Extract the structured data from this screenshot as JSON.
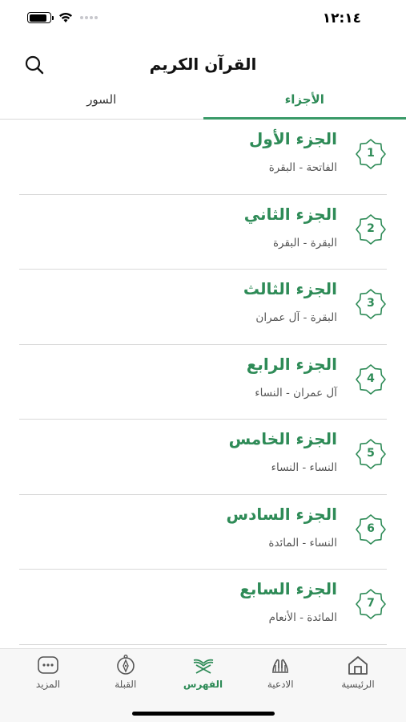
{
  "status": {
    "time": "١٢:١٤",
    "battery_level": 0.85
  },
  "header": {
    "title": "القرآن الكريم",
    "search_icon": "search-icon"
  },
  "tabs": [
    {
      "label": "الأجزاء",
      "active": true
    },
    {
      "label": "السور",
      "active": false
    }
  ],
  "juz_list": [
    {
      "number": "1",
      "title": "الجزء الأول",
      "range": "الفاتحة - البقرة"
    },
    {
      "number": "2",
      "title": "الجزء الثاني",
      "range": "البقرة - البقرة"
    },
    {
      "number": "3",
      "title": "الجزء الثالث",
      "range": "البقرة - آل عمران"
    },
    {
      "number": "4",
      "title": "الجزء الرابع",
      "range": "آل عمران - النساء"
    },
    {
      "number": "5",
      "title": "الجزء الخامس",
      "range": "النساء - النساء"
    },
    {
      "number": "6",
      "title": "الجزء السادس",
      "range": "النساء - المائدة"
    },
    {
      "number": "7",
      "title": "الجزء السابع",
      "range": "المائدة - الأنعام"
    }
  ],
  "tabbar": [
    {
      "label": "الرئيسية",
      "icon": "home-icon",
      "active": false
    },
    {
      "label": "الادعية",
      "icon": "praying-hands-icon",
      "active": false
    },
    {
      "label": "الفهرس",
      "icon": "quran-stand-icon",
      "active": true
    },
    {
      "label": "القبلة",
      "icon": "compass-icon",
      "active": false
    },
    {
      "label": "المزيد",
      "icon": "more-icon",
      "active": false
    }
  ],
  "colors": {
    "accent": "#2e8b57",
    "divider": "#d9d9d9",
    "tabbar_bg": "#f7f7f7"
  }
}
